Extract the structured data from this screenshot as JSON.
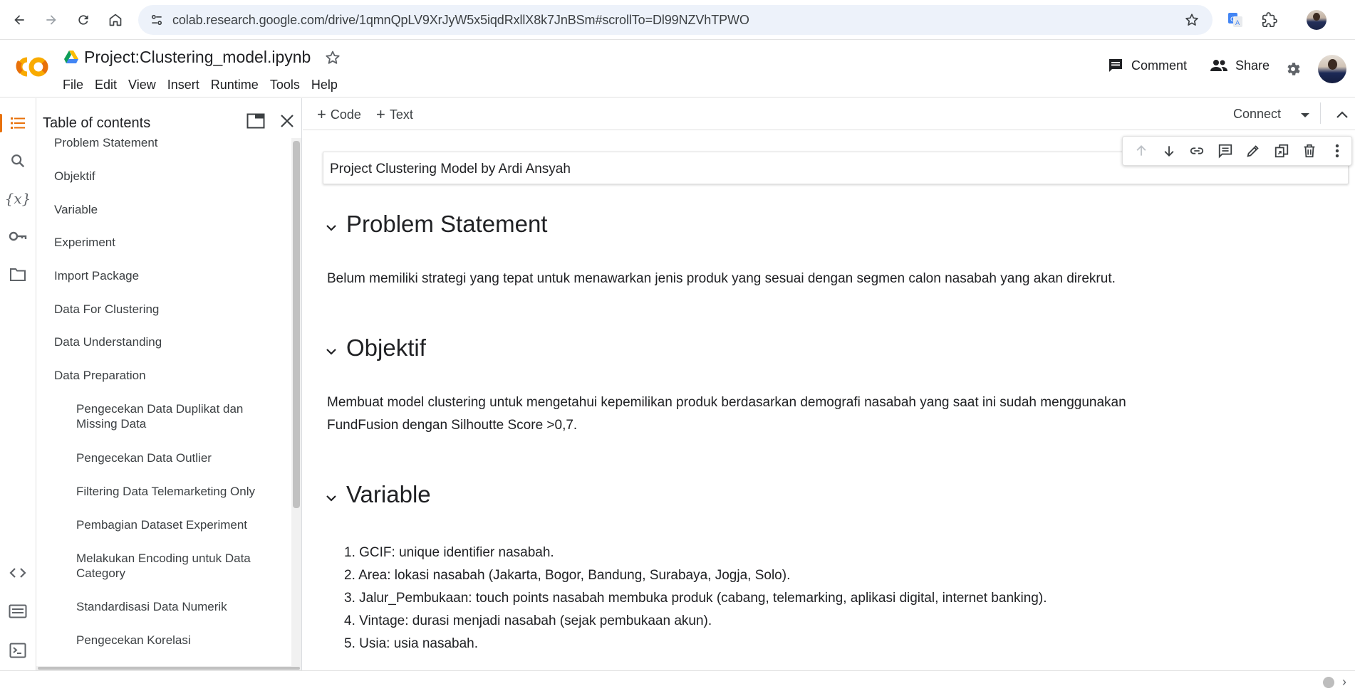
{
  "browser": {
    "url": "colab.research.google.com/drive/1qmnQpLV9XrJyW5x5iqdRxllX8k7JnBSm#scrollTo=Dl99NZVhTPWO",
    "icons": [
      "back-icon",
      "forward-icon",
      "reload-icon",
      "home-icon",
      "site-info-icon",
      "bookmark-star-icon",
      "translate-extension-icon",
      "extensions-puzzle-icon",
      "profile-avatar"
    ]
  },
  "header": {
    "notebook_title": "Project:Clustering_model.ipynb",
    "menu": [
      "File",
      "Edit",
      "View",
      "Insert",
      "Runtime",
      "Tools",
      "Help"
    ],
    "comment_label": "Comment",
    "share_label": "Share"
  },
  "toc": {
    "title": "Table of contents",
    "items": [
      {
        "label": "Problem Statement",
        "level": 1
      },
      {
        "label": "Objektif",
        "level": 1
      },
      {
        "label": "Variable",
        "level": 1
      },
      {
        "label": "Experiment",
        "level": 1
      },
      {
        "label": "Import Package",
        "level": 1
      },
      {
        "label": "Data For Clustering",
        "level": 1
      },
      {
        "label": "Data Understanding",
        "level": 1
      },
      {
        "label": "Data Preparation",
        "level": 1
      },
      {
        "label": "Pengecekan Data Duplikat dan Missing Data",
        "level": 2
      },
      {
        "label": "Pengecekan Data Outlier",
        "level": 2
      },
      {
        "label": "Filtering Data Telemarketing Only",
        "level": 2
      },
      {
        "label": "Pembagian Dataset Experiment",
        "level": 2
      },
      {
        "label": "Melakukan Encoding untuk Data Category",
        "level": 2
      },
      {
        "label": "Standardisasi Data Numerik",
        "level": 2
      },
      {
        "label": "Pengecekan Korelasi",
        "level": 2
      }
    ]
  },
  "toolbar": {
    "code_label": "Code",
    "text_label": "Text",
    "connect_label": "Connect"
  },
  "notebook": {
    "first_cell": "Project Clustering Model by Ardi Ansyah",
    "sections": [
      {
        "heading": "Problem Statement",
        "paragraph": "Belum memiliki strategi yang tepat untuk menawarkan jenis produk yang sesuai dengan segmen calon nasabah yang akan direkrut."
      },
      {
        "heading": "Objektif",
        "paragraph_line1": "Membuat model clustering untuk mengetahui kepemilikan produk berdasarkan demografi nasabah yang saat ini sudah menggunakan",
        "paragraph_line2": "FundFusion dengan Silhoutte Score >0,7."
      },
      {
        "heading": "Variable",
        "list": [
          "GCIF: unique identifier nasabah.",
          "Area: lokasi nasabah (Jakarta, Bogor, Bandung, Surabaya, Jogja, Solo).",
          "Jalur_Pembukaan: touch points nasabah membuka produk (cabang, telemarking, aplikasi digital, internet banking).",
          "Vintage: durasi menjadi nasabah (sejak pembukaan akun).",
          "Usia: usia nasabah."
        ]
      }
    ]
  },
  "colors": {
    "accent_orange": "#e8710a",
    "colab_yellow": "#f9ab00",
    "text": "#202124",
    "muted": "#5f6368"
  }
}
